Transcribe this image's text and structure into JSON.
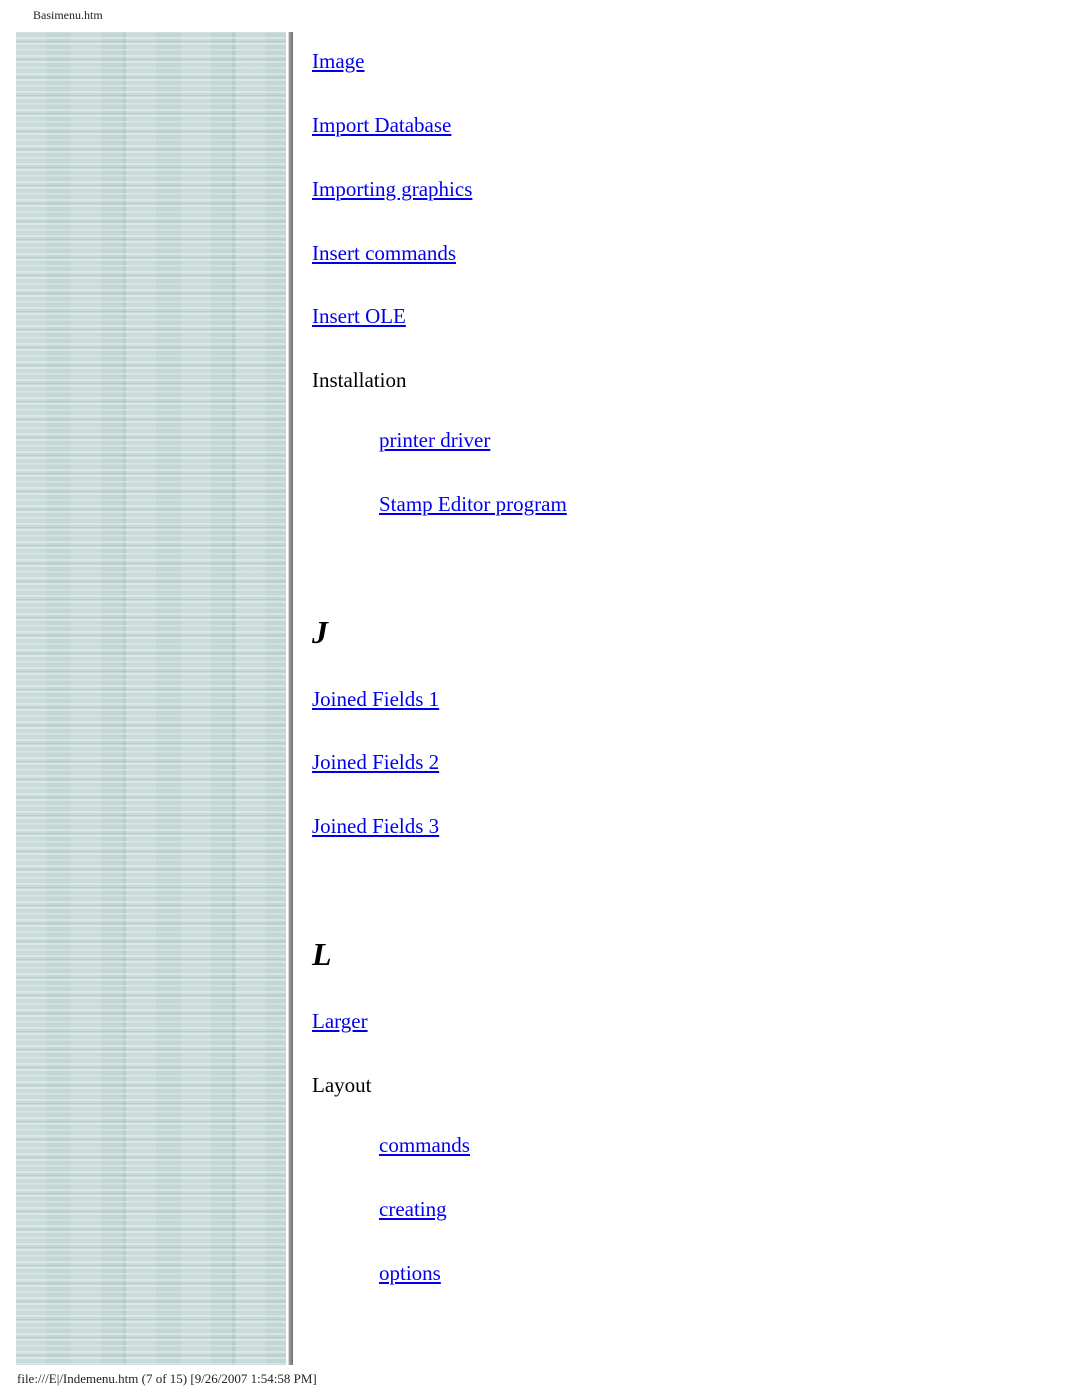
{
  "header": {
    "filename": "Basimenu.htm"
  },
  "sections": [
    {
      "items": [
        {
          "label": "Image",
          "type": "link"
        },
        {
          "label": "Import Database",
          "type": "link"
        },
        {
          "label": "Importing graphics",
          "type": "link"
        },
        {
          "label": "Insert commands",
          "type": "link"
        },
        {
          "label": "Insert OLE",
          "type": "link"
        },
        {
          "label": "Installation",
          "type": "text"
        },
        {
          "label": "printer driver",
          "type": "sublink"
        },
        {
          "label": "Stamp Editor program",
          "type": "sublink"
        }
      ]
    },
    {
      "letter": "J",
      "items": [
        {
          "label": "Joined Fields 1",
          "type": "link"
        },
        {
          "label": "Joined Fields 2",
          "type": "link"
        },
        {
          "label": "Joined Fields 3",
          "type": "link"
        }
      ]
    },
    {
      "letter": "L",
      "items": [
        {
          "label": "Larger",
          "type": "link"
        },
        {
          "label": "Layout",
          "type": "text"
        },
        {
          "label": "commands",
          "type": "sublink"
        },
        {
          "label": "creating",
          "type": "sublink"
        },
        {
          "label": "options",
          "type": "sublink"
        }
      ]
    }
  ],
  "footer": {
    "text": "file:///E|/Indemenu.htm (7 of 15) [9/26/2007 1:54:58 PM]"
  },
  "colors": {
    "link": "#0000ee",
    "sidebar": "#c3d6d6"
  }
}
